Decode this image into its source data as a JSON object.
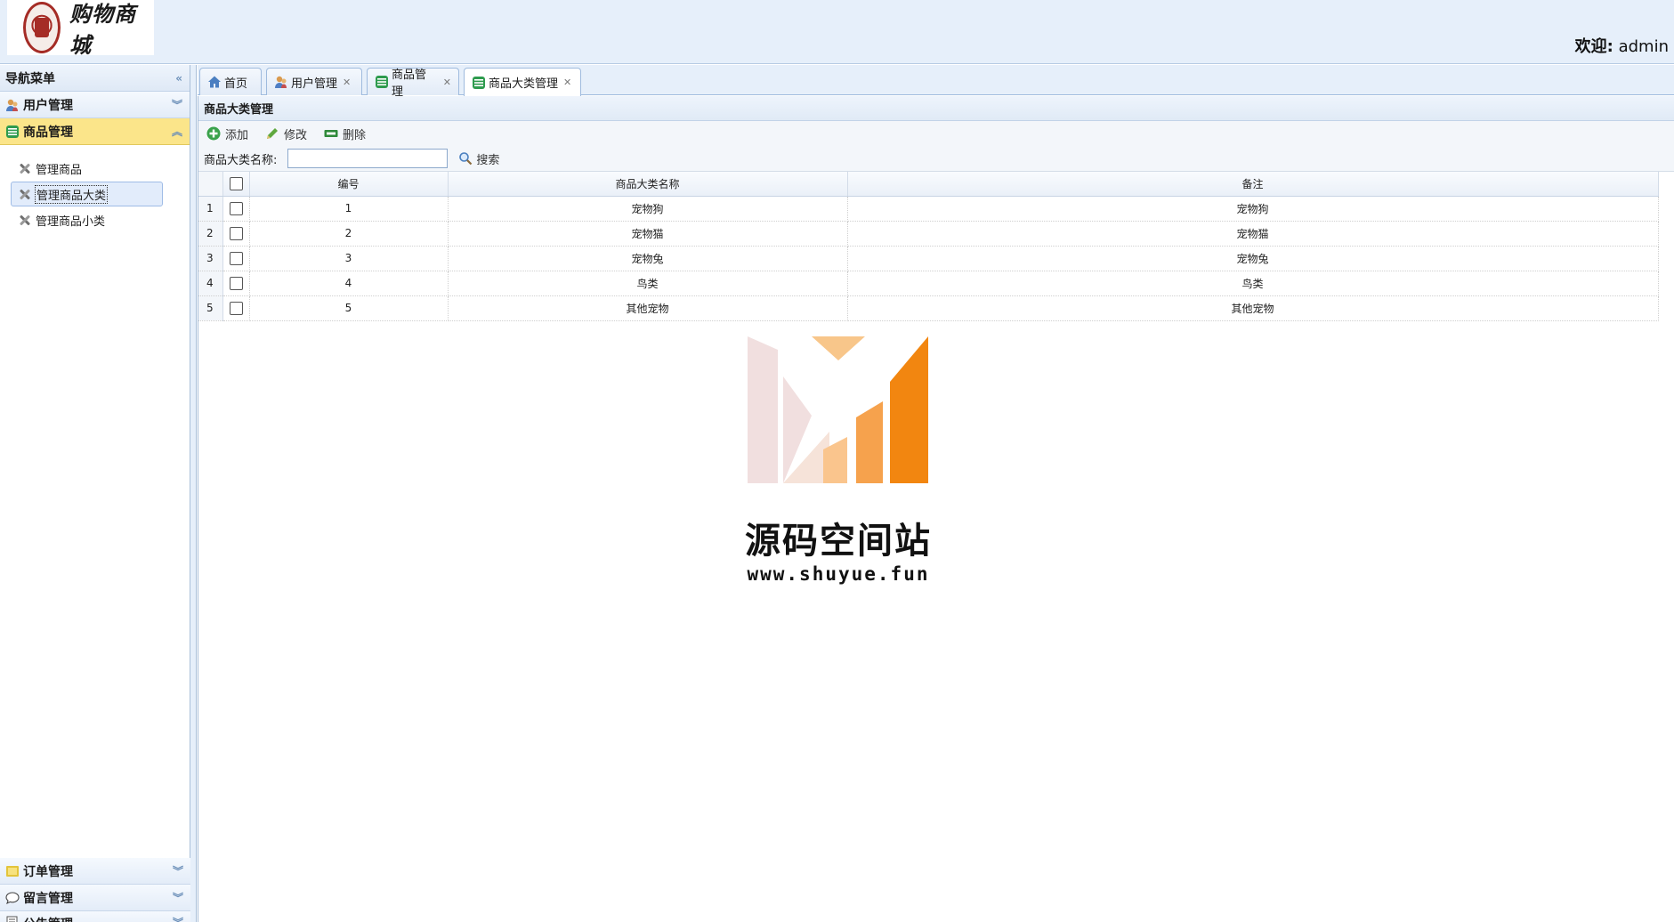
{
  "app": {
    "logo_text": "购物商城",
    "welcome_label": "欢迎:",
    "welcome_user": "admin"
  },
  "sidebar": {
    "title": "导航菜单",
    "groups": [
      {
        "label": "用户管理",
        "icon": "user-icon"
      },
      {
        "label": "商品管理",
        "icon": "grid-icon"
      },
      {
        "label": "订单管理",
        "icon": "folder-icon"
      },
      {
        "label": "留言管理",
        "icon": "chat-icon"
      },
      {
        "label": "公告管理",
        "icon": "note-icon"
      }
    ],
    "items": [
      {
        "label": "管理商品"
      },
      {
        "label": "管理商品大类"
      },
      {
        "label": "管理商品小类"
      }
    ]
  },
  "tabs": [
    {
      "label": "首页",
      "icon": "home-icon"
    },
    {
      "label": "用户管理",
      "icon": "user-icon"
    },
    {
      "label": "商品管理",
      "icon": "grid-icon"
    },
    {
      "label": "商品大类管理",
      "icon": "grid-icon"
    }
  ],
  "panel": {
    "title": "商品大类管理",
    "toolbar": {
      "add": "添加",
      "edit": "修改",
      "delete": "删除"
    },
    "search": {
      "label": "商品大类名称:",
      "value": "",
      "placeholder": "",
      "button": "搜索"
    }
  },
  "table": {
    "columns": [
      "编号",
      "商品大类名称",
      "备注"
    ],
    "rows": [
      {
        "rn": "1",
        "id": "1",
        "name": "宠物狗",
        "remark": "宠物狗"
      },
      {
        "rn": "2",
        "id": "2",
        "name": "宠物猫",
        "remark": "宠物猫"
      },
      {
        "rn": "3",
        "id": "3",
        "name": "宠物兔",
        "remark": "宠物兔"
      },
      {
        "rn": "4",
        "id": "4",
        "name": "鸟类",
        "remark": "鸟类"
      },
      {
        "rn": "5",
        "id": "5",
        "name": "其他宠物",
        "remark": "其他宠物"
      }
    ]
  },
  "watermark": {
    "title": "源码空间站",
    "url": "www.shuyue.fun"
  },
  "colors": {
    "header_bg": "#e6effa",
    "active_group": "#fbe58a",
    "border": "#9fbbde"
  }
}
